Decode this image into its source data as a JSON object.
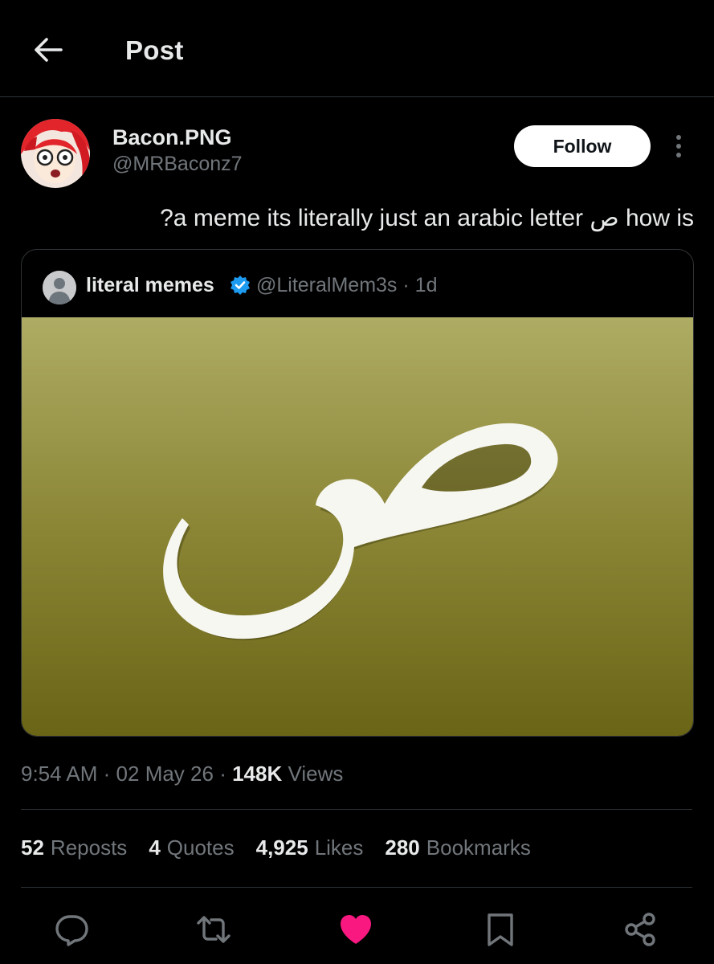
{
  "header": {
    "title": "Post"
  },
  "author": {
    "display_name": "Bacon.PNG",
    "handle": "@MRBaconz7",
    "follow_label": "Follow"
  },
  "post": {
    "text": "?a meme its literally just an arabic letter ص how is"
  },
  "quoted": {
    "name": "literal memes",
    "handle": "@LiteralMem3s",
    "time": "· 1d",
    "image_letter": "ص"
  },
  "meta": {
    "time": "9:54 AM",
    "date": "02 May 26",
    "views_count": "148K",
    "views_label": "Views",
    "dot": "·"
  },
  "stats": [
    {
      "count": "52",
      "label": "Reposts"
    },
    {
      "count": "4",
      "label": "Quotes"
    },
    {
      "count": "4,925",
      "label": "Likes"
    },
    {
      "count": "280",
      "label": "Bookmarks"
    }
  ],
  "actions": {
    "reply_icon": "reply-icon",
    "repost_icon": "repost-icon",
    "like_icon": "heart-icon",
    "bookmark_icon": "bookmark-icon",
    "share_icon": "share-icon"
  },
  "colors": {
    "like_active": "#f91880",
    "verified": "#1d9bf0",
    "secondary_text": "#71767b"
  }
}
